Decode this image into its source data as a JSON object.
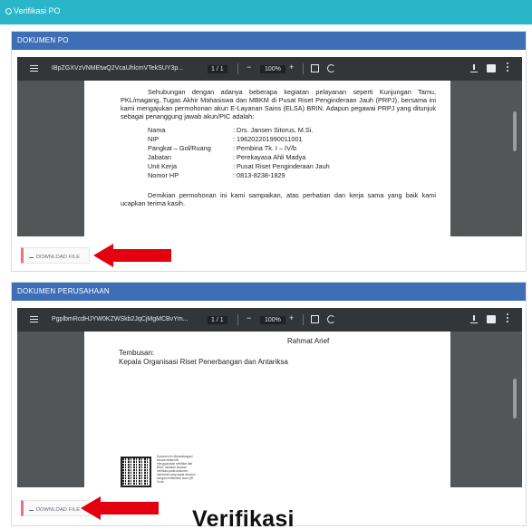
{
  "header": {
    "title": "Verifikasi PO"
  },
  "card1": {
    "title": "DOKUMEN PO",
    "viewer": {
      "filename": "IBpZGXVzVNMEtwQ2VcaUhlcmVTekSUY3p...",
      "page_indicator": "1 / 1",
      "zoom": "100%"
    },
    "doc": {
      "intro": "Sehubungan dengan adanya beberapa kegiatan pelayanan seperti Kunjungan Tamu, PKL/magang, Tugas Akhir Mahasiswa dan MBKM di Pusat Riset Penginderaan Jauh (PRPJ), bersama ini kami mengajukan permohonan akun E-Layanan Sains (ELSA) BRIN. Adapun pegawai PRPJ yang ditunjuk sebagai penanggung jawab akun/PIC adalah:",
      "fields": [
        {
          "key": "Nama",
          "value": ": Drs. Jansen Sitorus, M.Si."
        },
        {
          "key": "NIP",
          "value": ": 196202201990011001"
        },
        {
          "key": "Pangkat – Gol/Ruang",
          "value": ": Pembina Tk. I – IV/b"
        },
        {
          "key": "Jabatan",
          "value": ": Perekayasa Ahli Madya"
        },
        {
          "key": "Unit Kerja",
          "value": ": Pusat Riset Penginderaan Jauh"
        },
        {
          "key": "Nomor HP",
          "value": ": 0813-8238-1829"
        }
      ],
      "closing": "Demikian permohonan ini kami sampaikan, atas perhatian dan kerja sama yang baik kami ucapkan terima kasih."
    },
    "download_label": "DOWNLOAD FILE"
  },
  "card2": {
    "title": "DOKUMEN PERUSAHAAN",
    "viewer": {
      "filename": "PgplbmRcdHJYW0KZWSkb2JqCjMgMCBvYm...",
      "page_indicator": "1 / 1",
      "zoom": "100%"
    },
    "doc": {
      "signatory": "Rahmat Arief",
      "cc_label": "Tembusan:",
      "cc_item": "Kepala Organisasi Riset Penerbangan dan Antariksa",
      "qr_note": "Dokumen ini ditandatangani secara elektronik menggunakan sertifikat dari BSrE, silahkan lakukan verifikasi pada dokumen elektronik yang dapat diunduh dengan melakukan scan QR Code"
    },
    "download_label": "DOWNLOAD FILE"
  },
  "caption": "Verifikasi",
  "colors": {
    "header": "#29b6c8",
    "card_head": "#3e6fb6",
    "arrow": "#e3000f",
    "viewer_bg": "#525659"
  }
}
